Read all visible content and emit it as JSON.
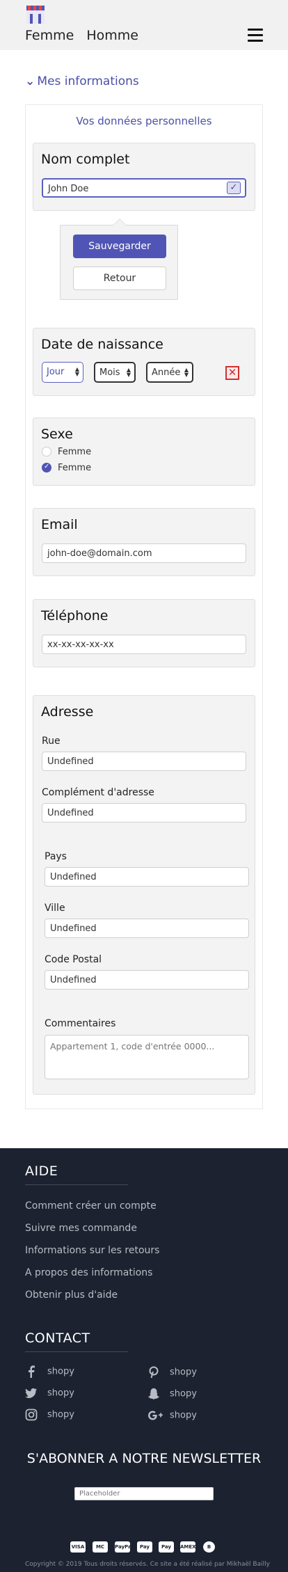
{
  "header": {
    "nav": [
      "Femme",
      "Homme"
    ],
    "menu_icon": "hamburger-icon",
    "logo_icon": "shop-logo-icon"
  },
  "section_toggle": "Mes informations",
  "personal": {
    "title": "Vos données personnelles",
    "nom_complet": {
      "label": "Nom complet",
      "value": "John Doe"
    },
    "popover": {
      "save": "Sauvegarder",
      "back": "Retour"
    },
    "naissance": {
      "label": "Date de naissance",
      "jour": "Jour",
      "mois": "Mois",
      "annee": "Année"
    },
    "sexe": {
      "label": "Sexe",
      "options": [
        "Femme",
        "Femme"
      ],
      "selected_index": 1
    },
    "email": {
      "label": "Email",
      "value": "john-doe@domain.com"
    },
    "telephone": {
      "label": "Téléphone",
      "value": "xx-xx-xx-xx-xx"
    },
    "adresse": {
      "label": "Adresse",
      "rue": {
        "label": "Rue",
        "value": "Undefined"
      },
      "complement": {
        "label": "Complément d'adresse",
        "value": "Undefined"
      },
      "pays": {
        "label": "Pays",
        "value": "Undefined"
      },
      "ville": {
        "label": "Ville",
        "value": "Undefined"
      },
      "code_postal": {
        "label": "Code Postal",
        "value": "Undefined"
      },
      "commentaires": {
        "label": "Commentaires",
        "placeholder": "Appartement 1, code d'entrée 0000..."
      }
    }
  },
  "footer": {
    "aide": {
      "title": "AIDE",
      "links": [
        "Comment créer un compte",
        "Suivre mes commande",
        "Informations sur les retours",
        "A propos des informations",
        "Obtenir plus d'aide"
      ]
    },
    "contact": {
      "title": "CONTACT",
      "items": [
        {
          "icon": "facebook-icon",
          "label": "shopy"
        },
        {
          "icon": "pinterest-icon",
          "label": "shopy"
        },
        {
          "icon": "twitter-icon",
          "label": "shopy"
        },
        {
          "icon": "snapchat-icon",
          "label": "shopy"
        },
        {
          "icon": "instagram-icon",
          "label": "shopy"
        },
        {
          "icon": "google-plus-icon",
          "label": "shopy"
        }
      ]
    },
    "newsletter": {
      "title": "S'ABONNER A NOTRE NEWSLETTER",
      "placeholder": "Placeholder"
    },
    "payments": [
      "VISA",
      "MC",
      "PayPal",
      "Pay",
      "Pay",
      "AMEX",
      "B"
    ],
    "copyright": "Copyright © 2019 Tous droits réservés. Ce site a été réalisé par Mikhaël Bailly"
  },
  "colors": {
    "accent": "#5055b5",
    "footer_bg": "#1c2230",
    "error": "#d03030"
  }
}
